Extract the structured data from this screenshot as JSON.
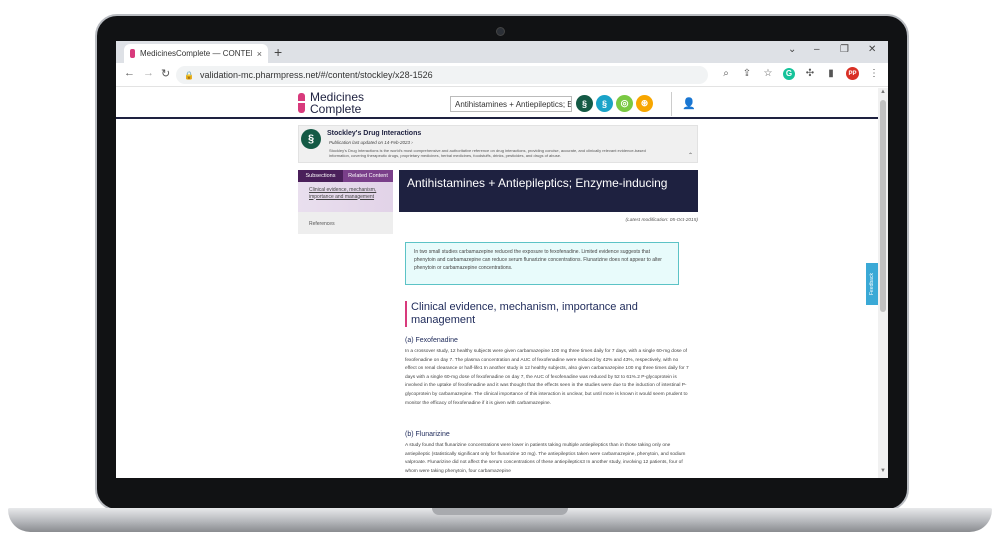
{
  "browser": {
    "tab_title": "MedicinesComplete — CONTENT",
    "tab_close": "×",
    "new_tab": "+",
    "url": "validation-mc.pharmpress.net/#/content/stockley/x28-1526",
    "avatar_initials": "PP",
    "grammarly_label": "G"
  },
  "site": {
    "logo_line1": "Medicines",
    "logo_line2": "Complete",
    "search_value": "Antihistamines + Antiepileptics; Enz"
  },
  "banner": {
    "title": "Stockley's Drug Interactions",
    "date": "Publication last updated on 14-Feb-2023 ›",
    "description": "Stockley's Drug Interactions is the world's most comprehensive and authoritative reference on drug interactions, providing concise, accurate, and clinically relevant evidence-based information, covering therapeutic drugs, proprietary medicines, herbal medicines, foodstuffs, drinks, pesticides, and drugs of abuse."
  },
  "sidebar": {
    "tab_subsections": "Subsections",
    "tab_related": "Related Content",
    "item1": "Clinical evidence, mechanism, importance and management",
    "item2": "References"
  },
  "article": {
    "title": "Antihistamines + Antiepileptics; Enzyme-inducing",
    "last_modified": "(Latest modification: 05-Oct-2015)",
    "summary": "In two small studies carbamazepine reduced the exposure to fexofenadine. Limited evidence suggests that phenytoin and carbamazepine can reduce serum flunarizine concentrations. Flunarizine does not appear to alter phenytoin or carbamazepine concentrations.",
    "section_heading": "Clinical evidence, mechanism, importance and management",
    "sub_a": "(a) Fexofenadine",
    "para_a": "In a crossover study, 12 healthy subjects were given carbamazepine 100 mg three times daily for 7 days, with a single 60-mg dose of fexofenadine on day 7. The plasma concentration and AUC of fexofenadine were reduced by 42% and 43%, respectively, with no effect on renal clearance or half-life1 In another study in 12 healthy subjects, also given carbamazepine 100 mg three times daily for 7 days with a single 60-mg dose of fexofenadine on day 7, the AUC of fexofenadine was reduced by 52 to 61%.2 P-glycoprotein is involved in the uptake of fexofenadine and it was thought that the effects seen in the studies were due to the induction of intestinal P-glycoprotein by carbamazepine. The clinical importance of this interaction is unclear, but until more is known it would seem prudent to monitor the efficacy of fexofenadine if it is given with carbamazepine.",
    "sub_b": "(b) Flunarizine",
    "para_b": "A study found that flunarizine concentrations were lower in patients taking multiple antiepileptics than in those taking only one antiepileptic (statistically significant only for flunarizine 10 mg). The antiepileptics taken were carbamazepine, phenytoin, and sodium valproate. Flunarizine did not affect the serum concentrations of these antiepileptics3 In another study, involving 12 patients, four of whom were taking phenytoin, four carbamazepine"
  },
  "feedback_label": "Feedback",
  "colors": {
    "navy": "#1e2140",
    "pink": "#d83a7c",
    "purple": "#4a1f5a",
    "teal_box": "#e8fbfb"
  }
}
